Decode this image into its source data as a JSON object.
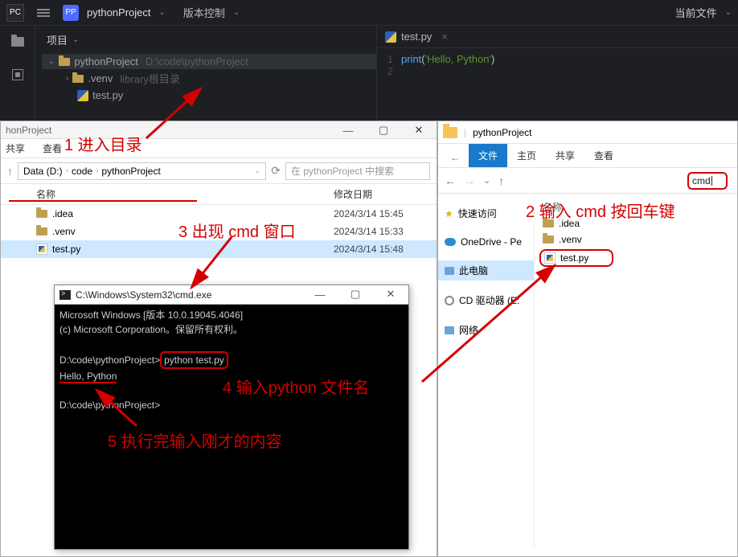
{
  "pycharm": {
    "logo": "PC",
    "pp": "PP",
    "project": "pythonProject",
    "version_ctrl": "版本控制",
    "right_label": "当前文件",
    "sidebar": {
      "header": "项目"
    },
    "tree": {
      "root": "pythonProject",
      "root_path": "D:\\code\\pythonProject",
      "venv": ".venv",
      "venv_hint": "library根目录",
      "testpy": "test.py"
    },
    "tab": "test.py",
    "code": {
      "line1_num": "1",
      "line2_num": "2",
      "fn": "print",
      "open": "(",
      "str": "'Hello, Python'",
      "close": ")"
    }
  },
  "explorerLeft": {
    "title": "honProject",
    "menu": {
      "share": "共享",
      "view": "查看"
    },
    "breadcrumb": {
      "drive": "Data (D:)",
      "p1": "code",
      "p2": "pythonProject"
    },
    "search_ph": "在 pythonProject 中搜索",
    "cols": {
      "name": "名称",
      "date": "修改日期"
    },
    "rows": [
      {
        "name": ".idea",
        "type": "folder",
        "date": "2024/3/14 15:45"
      },
      {
        "name": ".venv",
        "type": "folder",
        "date": "2024/3/14 15:33"
      },
      {
        "name": "test.py",
        "type": "py",
        "date": "2024/3/14 15:48"
      }
    ]
  },
  "cmd": {
    "title": "C:\\Windows\\System32\\cmd.exe",
    "line1": "Microsoft Windows [版本 10.0.19045.4046]",
    "line2": "(c) Microsoft Corporation。保留所有权利。",
    "prompt1": "D:\\code\\pythonProject>",
    "command": "python test.py",
    "output": "Hello, Python",
    "prompt2": "D:\\code\\pythonProject>"
  },
  "explorerRight": {
    "title": "pythonProject",
    "tabs": {
      "file": "文件",
      "home": "主页",
      "share": "共享",
      "view": "查看"
    },
    "arrow_help": "?",
    "addr": "cmd",
    "side": {
      "quick": "快速访问",
      "onedrive": "OneDrive - Pe",
      "thispc": "此电脑",
      "cd": "CD 驱动器 (E:",
      "net": "网络"
    },
    "col_name": "名称",
    "files": [
      {
        "name": ".idea",
        "type": "folder"
      },
      {
        "name": ".venv",
        "type": "folder"
      },
      {
        "name": "test.py",
        "type": "py"
      }
    ]
  },
  "annotations": {
    "a1": "1 进入目录",
    "a2": "2 输入 cmd 按回车键",
    "a3": "3 出现 cmd 窗口",
    "a4": "4 输入python 文件名",
    "a5": "5 执行完输入刚才的内容"
  }
}
